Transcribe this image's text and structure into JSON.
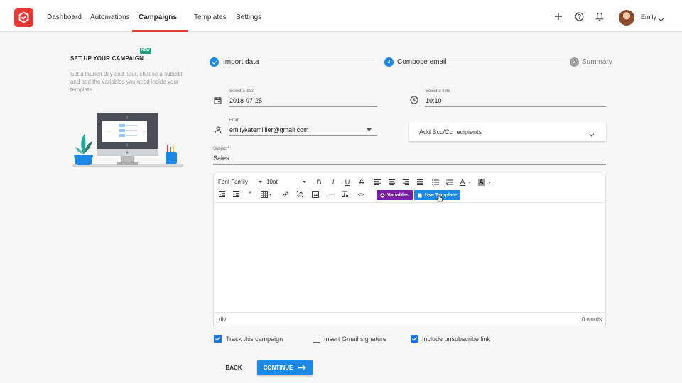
{
  "nav": {
    "items": [
      {
        "label": "Dashboard"
      },
      {
        "label": "Automations"
      },
      {
        "label": "Campaigns",
        "badge": "NEW",
        "active": true
      },
      {
        "label": "Templates"
      },
      {
        "label": "Settings"
      }
    ]
  },
  "user": {
    "name": "Emily"
  },
  "sidebar": {
    "title": "SET UP YOUR CAMPAIGN",
    "description": "Set a launch day and hour, choose a subject and add the variables you need inside your template"
  },
  "stepper": {
    "steps": [
      {
        "number": "1",
        "label": "Import data",
        "state": "done"
      },
      {
        "number": "2",
        "label": "Compose email",
        "state": "current"
      },
      {
        "number": "3",
        "label": "Summary",
        "state": "pending"
      }
    ]
  },
  "form": {
    "date": {
      "label": "Select a date",
      "value": "2018-07-25"
    },
    "time": {
      "label": "Select a time",
      "value": "10:10"
    },
    "from": {
      "label": "From",
      "value": "emilykatemilller@gmail.com"
    },
    "bcc": {
      "label": "Add Bcc/Cc recipients"
    },
    "subject": {
      "label": "Subject*",
      "value": "Sales"
    }
  },
  "editor": {
    "font_family": "Font Family",
    "font_size": "10pt",
    "variables_label": "Variables",
    "template_label": "Use Template",
    "status_path": "div",
    "word_count": "0 words"
  },
  "options": [
    {
      "label": "Track this campaign",
      "checked": true
    },
    {
      "label": "Insert Gmail signature",
      "checked": false
    },
    {
      "label": "Include unsubscribe link",
      "checked": true
    }
  ],
  "actions": {
    "back": "BACK",
    "continue": "CONTINUE"
  },
  "colors": {
    "brand": "#e53935",
    "primary": "#1e88e5",
    "variables": "#7b1fa2",
    "new_badge": "#1e9e7a"
  }
}
